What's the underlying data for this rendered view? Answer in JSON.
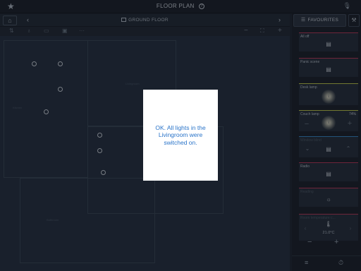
{
  "topbar": {
    "title": "FLOOR PLAN",
    "help_icon": "?",
    "star_icon": "star-icon",
    "mic_icon": "microphone-icon"
  },
  "floorbar": {
    "floor_name": "GROUND FLOOR",
    "prev": "‹",
    "next": "›"
  },
  "toolbar": {
    "zoom_out": "−",
    "zoom_in": "+",
    "more": "···"
  },
  "plan": {
    "rooms": [
      {
        "label": "Kitchen"
      },
      {
        "label": "Livingroom"
      },
      {
        "label": "Hall"
      },
      {
        "label": "Bathroom"
      }
    ]
  },
  "dialog": {
    "message": "OK. All lights in the Livingroom were switched on."
  },
  "panel": {
    "tab_label": "FAVOURITES",
    "cards": [
      {
        "label": "All off",
        "accent": "#c0395a"
      },
      {
        "label": "Panic scene",
        "accent": "#c0395a"
      },
      {
        "label": "Desk lamp",
        "accent": "#c9d14a"
      },
      {
        "label": "Couch lamp",
        "value": "74%",
        "accent": "#c9d14a"
      },
      {
        "label": "Window blind",
        "accent": "#3a8fd0"
      },
      {
        "label": "Radio",
        "accent": "#c0395a"
      },
      {
        "label": "Reading",
        "accent": "#c0395a"
      },
      {
        "label": "Room temperature c...",
        "value_temp": "21.0°C",
        "accent": "#c0395a"
      }
    ]
  },
  "colors": {
    "dialog_text": "#2a74c9",
    "background": "#1e2630"
  }
}
